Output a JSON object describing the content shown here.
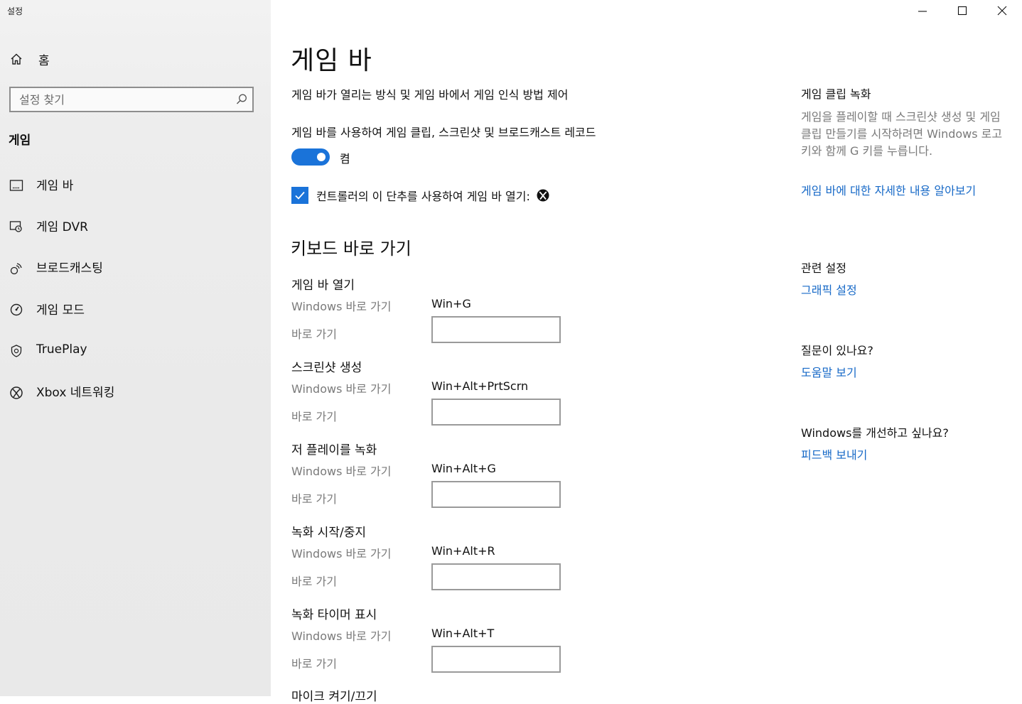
{
  "window": {
    "title": "설정",
    "controls": [
      "minimize-icon",
      "maximize-icon",
      "close-icon"
    ]
  },
  "sidebar": {
    "home_label": "홈",
    "search_placeholder": "설정 찾기",
    "section_title": "게임",
    "items": [
      {
        "label": "게임 바",
        "icon": "game-bar-icon"
      },
      {
        "label": "게임 DVR",
        "icon": "game-dvr-icon"
      },
      {
        "label": "브로드캐스팅",
        "icon": "broadcasting-icon"
      },
      {
        "label": "게임 모드",
        "icon": "game-mode-icon"
      },
      {
        "label": "TruePlay",
        "icon": "trueplay-icon"
      },
      {
        "label": "Xbox 네트워킹",
        "icon": "xbox-icon"
      }
    ]
  },
  "main": {
    "title": "게임 바",
    "description": "게임 바가 열리는 방식 및 게임 바에서 게임 인식 방법 제어",
    "toggle_label": "게임 바를 사용하여 게임 클립, 스크린샷 및 브로드캐스트 레코드",
    "toggle_state": "켬",
    "toggle_on": true,
    "checkbox_label": "컨트롤러의 이 단추를 사용하여 게임 바 열기:",
    "checkbox_checked": true,
    "keyboard_heading": "키보드 바로 가기",
    "shortcuts": [
      {
        "name": "게임 바 열기",
        "windows_label": "Windows 바로 가기",
        "windows_value": "Win+G",
        "custom_label": "바로 가기"
      },
      {
        "name": "스크린샷 생성",
        "windows_label": "Windows 바로 가기",
        "windows_value": "Win+Alt+PrtScrn",
        "custom_label": "바로 가기"
      },
      {
        "name": "저 플레이를 녹화",
        "windows_label": "Windows 바로 가기",
        "windows_value": "Win+Alt+G",
        "custom_label": "바로 가기"
      },
      {
        "name": "녹화 시작/중지",
        "windows_label": "Windows 바로 가기",
        "windows_value": "Win+Alt+R",
        "custom_label": "바로 가기"
      },
      {
        "name": "녹화 타이머 표시",
        "windows_label": "Windows 바로 가기",
        "windows_value": "Win+Alt+T",
        "custom_label": "바로 가기"
      },
      {
        "name": "마이크 켜기/끄기"
      }
    ]
  },
  "right_panel": {
    "clip_title": "게임 클립 녹화",
    "clip_text": "게임을 플레이할 때 스크린샷 생성 및 게임 클립 만들기를 시작하려면 Windows 로고 키와 함께 G 키를 누릅니다.",
    "clip_link": "게임 바에 대한 자세한 내용 알아보기",
    "related_title": "관련 설정",
    "related_link": "그래픽 설정",
    "question_title": "질문이 있나요?",
    "question_link": "도움말 보기",
    "improve_title": "Windows를 개선하고 싶나요?",
    "improve_link": "피드백 보내기"
  },
  "colors": {
    "accent": "#1a73d9",
    "link": "#1769c7",
    "sidebar_bg": "#ececec",
    "muted_text": "#7a7a7a"
  }
}
